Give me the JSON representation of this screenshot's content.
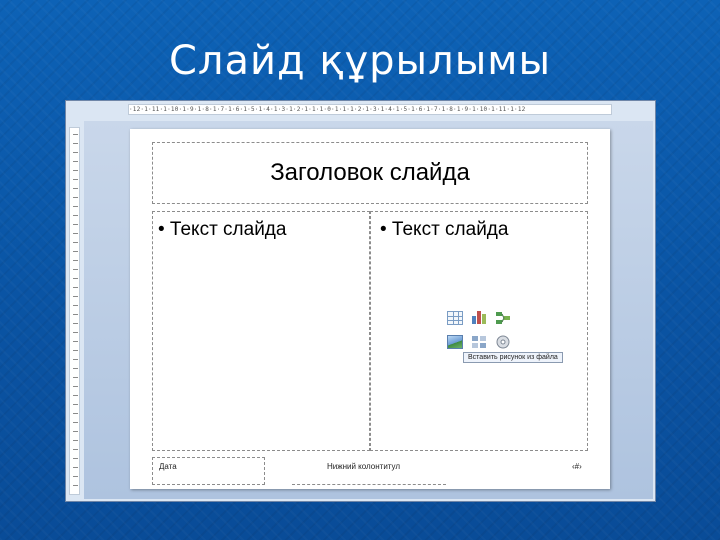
{
  "slide_heading": "Слайд құрылымы",
  "ruler_top_text": "·12·1·11·1·10·1·9·1·8·1·7·1·6·1·5·1·4·1·3·1·2·1·1·1·0·1·1·1·2·1·3·1·4·1·5·1·6·1·7·1·8·1·9·1·10·1·11·1·12",
  "slide": {
    "title": "Заголовок слайда",
    "left_bullet": "• Текст слайда",
    "right_bullet": "• Текст слайда",
    "date": "Дата",
    "footer": "Нижний колонтитул",
    "slide_number": "‹#›"
  },
  "insert_content": {
    "icons": [
      "table-icon",
      "chart-icon",
      "smartart-icon",
      "picture-icon",
      "clipart-icon",
      "media-icon"
    ],
    "tooltip": "Вставить рисунок из файла"
  },
  "colors": {
    "background": "#0a58a8",
    "workspace": "#c9d7ea",
    "chart_bar_1": "#4f81bd",
    "chart_bar_2": "#c0504d",
    "chart_bar_3": "#9bbb59"
  }
}
